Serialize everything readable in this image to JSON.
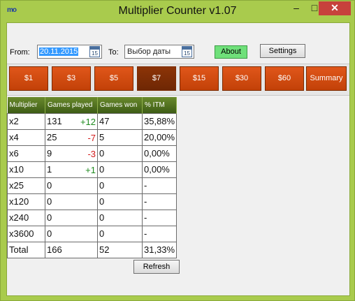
{
  "window": {
    "title": "Multiplier Counter v1.07",
    "app_icon_text": "mo",
    "minimize": "–",
    "maximize": "□",
    "close": "✕"
  },
  "filters": {
    "from_label": "From:",
    "from_value": "20.11.2015",
    "to_label": "To:",
    "to_value": "Выбор даты",
    "calendar_icon_text": "15",
    "about_label": "About",
    "settings_label": "Settings"
  },
  "stakes": [
    "$1",
    "$3",
    "$5",
    "$7",
    "$15",
    "$30",
    "$60",
    "Summary"
  ],
  "active_stake": "$7",
  "table": {
    "headers": [
      "Multiplier",
      "Games played",
      "Games won",
      "% ITM"
    ],
    "rows": [
      {
        "multiplier": "x2",
        "played": "131",
        "delta": "+12",
        "delta_sign": "pos",
        "won": "47",
        "itm": "35,88%"
      },
      {
        "multiplier": "x4",
        "played": "25",
        "delta": "-7",
        "delta_sign": "neg",
        "won": "5",
        "itm": "20,00%"
      },
      {
        "multiplier": "x6",
        "played": "9",
        "delta": "-3",
        "delta_sign": "neg",
        "won": "0",
        "itm": "0,00%"
      },
      {
        "multiplier": "x10",
        "played": "1",
        "delta": "+1",
        "delta_sign": "pos",
        "won": "0",
        "itm": "0,00%"
      },
      {
        "multiplier": "x25",
        "played": "0",
        "delta": "",
        "delta_sign": "",
        "won": "0",
        "itm": "-"
      },
      {
        "multiplier": "x120",
        "played": "0",
        "delta": "",
        "delta_sign": "",
        "won": "0",
        "itm": "-"
      },
      {
        "multiplier": "x240",
        "played": "0",
        "delta": "",
        "delta_sign": "",
        "won": "0",
        "itm": "-"
      },
      {
        "multiplier": "x3600",
        "played": "0",
        "delta": "",
        "delta_sign": "",
        "won": "0",
        "itm": "-"
      },
      {
        "multiplier": "Total",
        "played": "166",
        "delta": "",
        "delta_sign": "",
        "won": "52",
        "itm": "31,33%"
      }
    ]
  },
  "refresh_label": "Refresh",
  "colors": {
    "window_frame": "#a9cb4d",
    "stake_button": "#d04a10",
    "stake_button_active": "#7d2e05",
    "header_green": "#4f6f1f",
    "about_green": "#6fe07a",
    "positive_delta": "#1e8a1e",
    "negative_delta": "#d21b1b"
  }
}
